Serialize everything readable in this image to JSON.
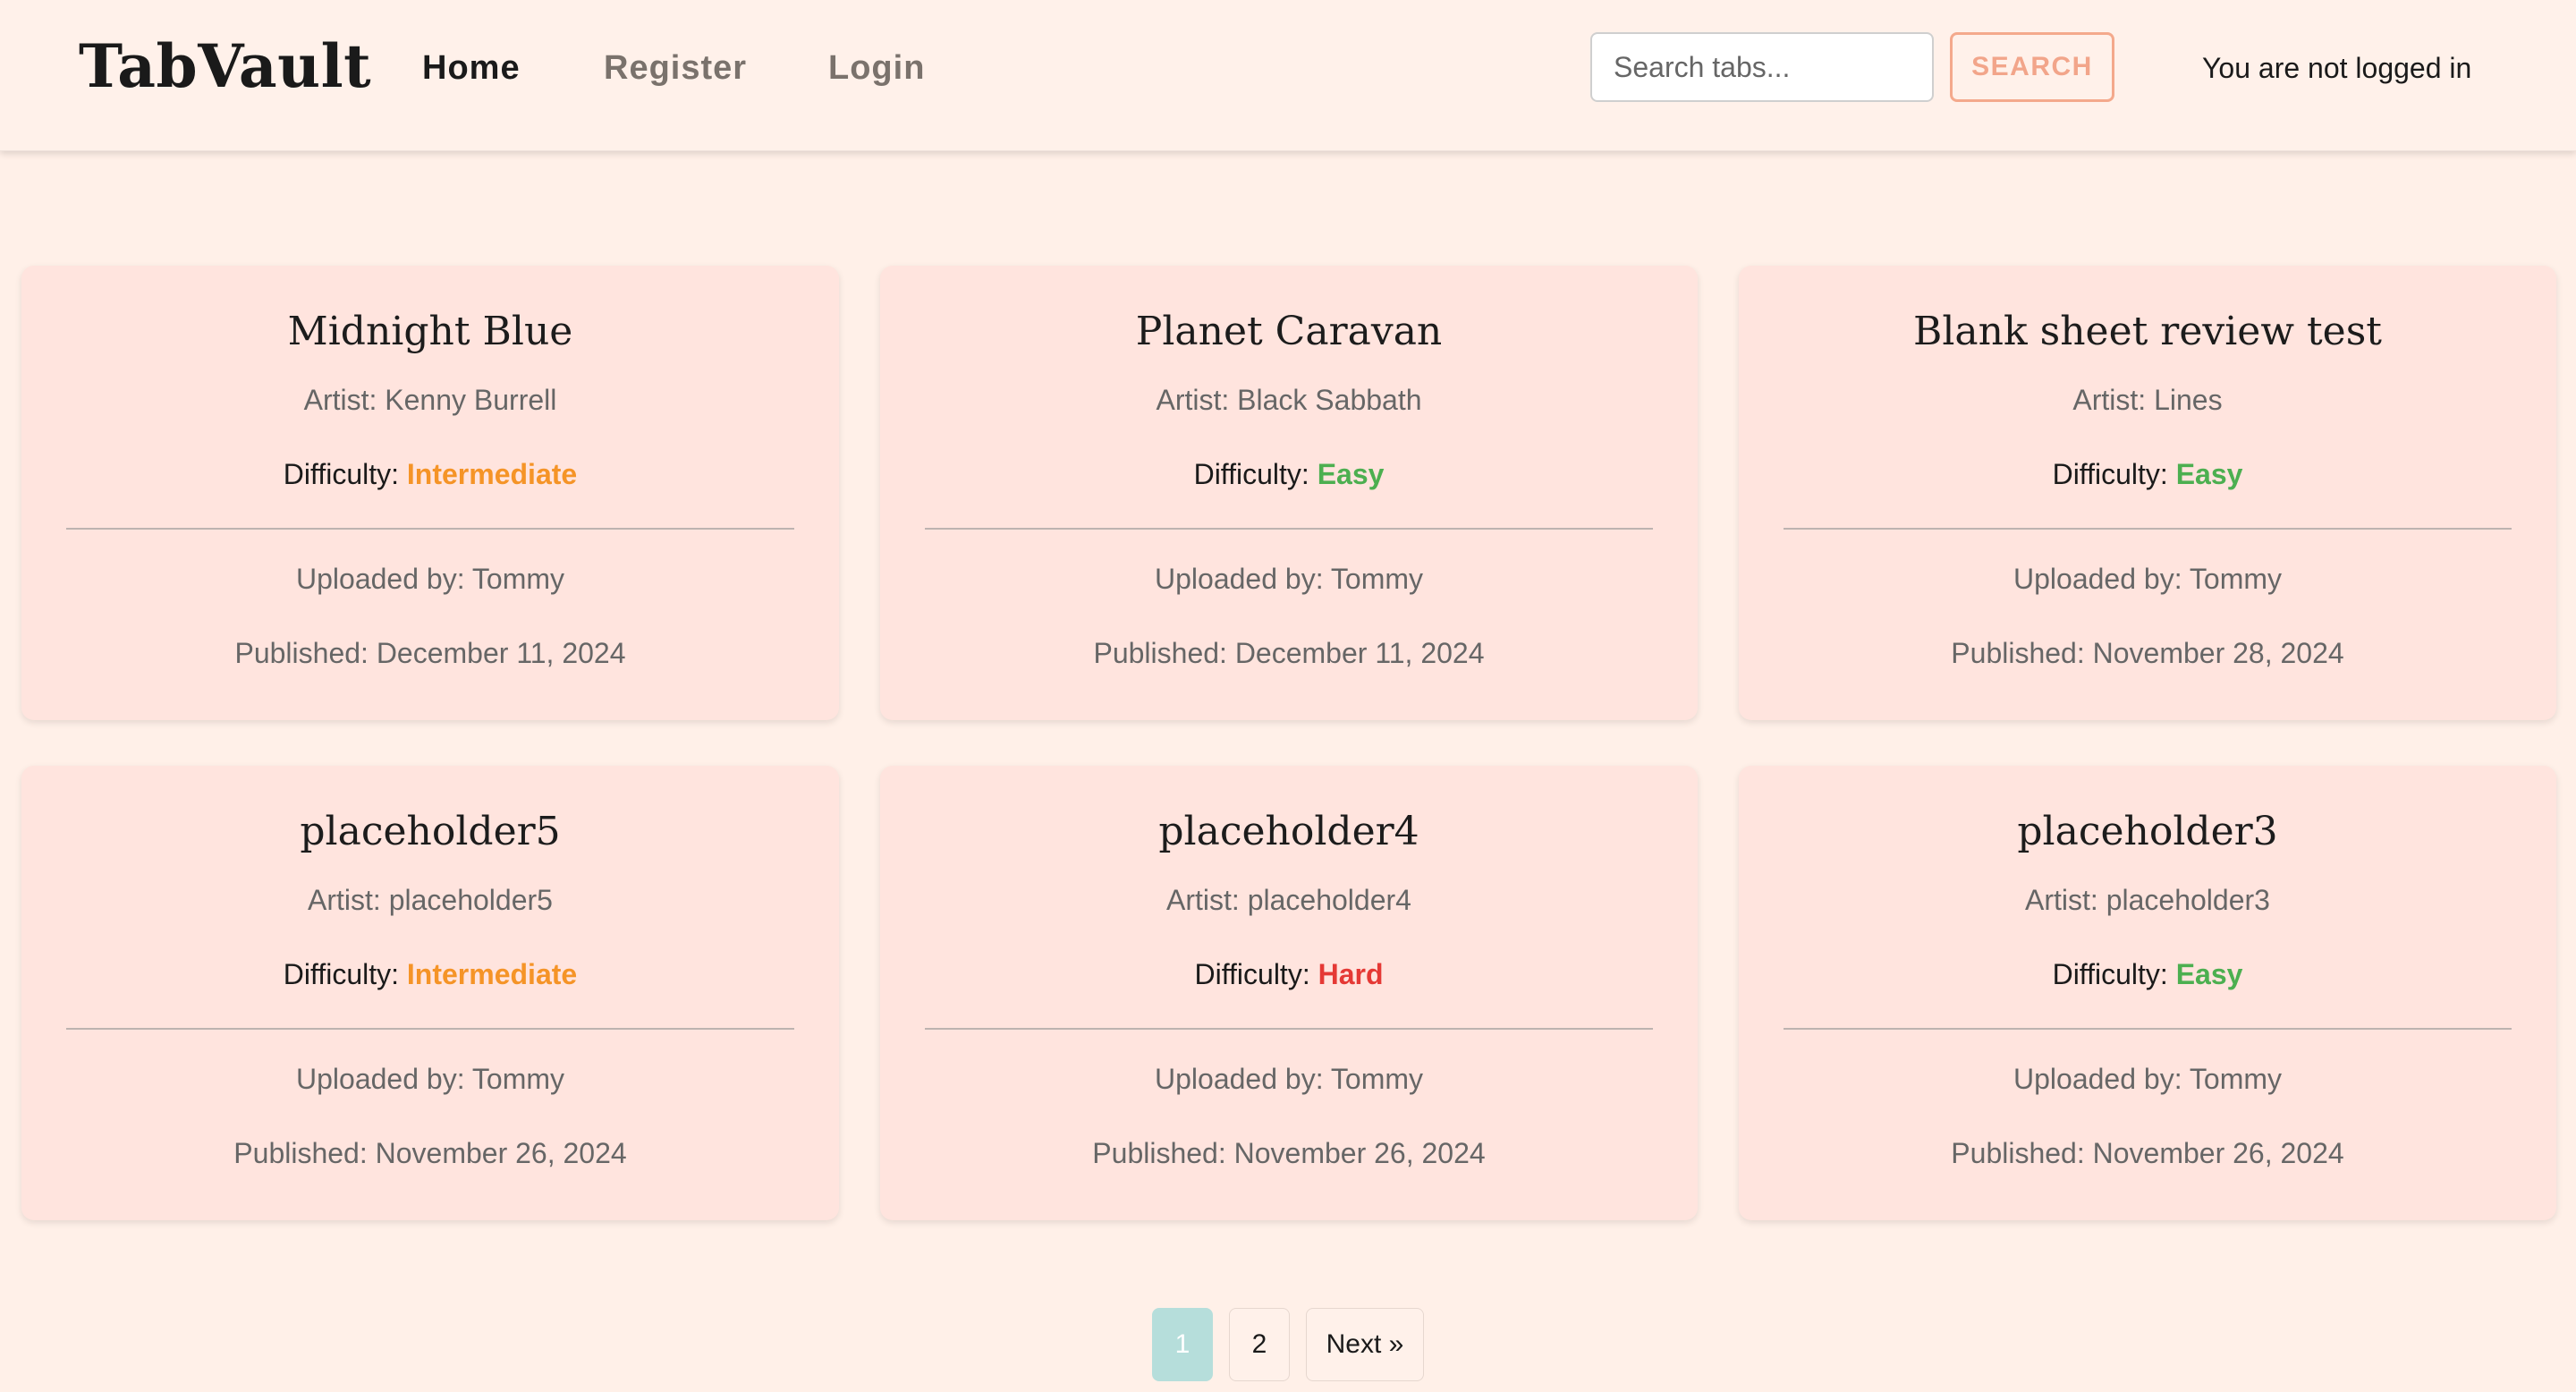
{
  "header": {
    "brand": "TabVault",
    "nav": [
      {
        "label": "Home"
      },
      {
        "label": "Register"
      },
      {
        "label": "Login"
      }
    ],
    "search": {
      "placeholder": "Search tabs...",
      "value": "",
      "button_label": "SEARCH"
    },
    "auth_status": "You are not logged in"
  },
  "labels": {
    "artist_prefix": "Artist: ",
    "difficulty_prefix": "Difficulty: ",
    "uploader_prefix": "Uploaded by: ",
    "published_prefix": "Published: "
  },
  "cards": [
    {
      "title": "Midnight Blue",
      "artist": "Kenny Burrell",
      "difficulty": "Intermediate",
      "uploader": "Tommy",
      "published": "December 11, 2024"
    },
    {
      "title": "Planet Caravan",
      "artist": "Black Sabbath",
      "difficulty": "Easy",
      "uploader": "Tommy",
      "published": "December 11, 2024"
    },
    {
      "title": "Blank sheet review test",
      "artist": "Lines",
      "difficulty": "Easy",
      "uploader": "Tommy",
      "published": "November 28, 2024"
    },
    {
      "title": "placeholder5",
      "artist": "placeholder5",
      "difficulty": "Intermediate",
      "uploader": "Tommy",
      "published": "November 26, 2024"
    },
    {
      "title": "placeholder4",
      "artist": "placeholder4",
      "difficulty": "Hard",
      "uploader": "Tommy",
      "published": "November 26, 2024"
    },
    {
      "title": "placeholder3",
      "artist": "placeholder3",
      "difficulty": "Easy",
      "uploader": "Tommy",
      "published": "November 26, 2024"
    }
  ],
  "difficulty_colors": {
    "Intermediate": "#f59427",
    "Easy": "#4caf50",
    "Hard": "#e53935"
  },
  "pagination": {
    "pages": [
      "1",
      "2"
    ],
    "current": "1",
    "next_label": "Next »"
  }
}
